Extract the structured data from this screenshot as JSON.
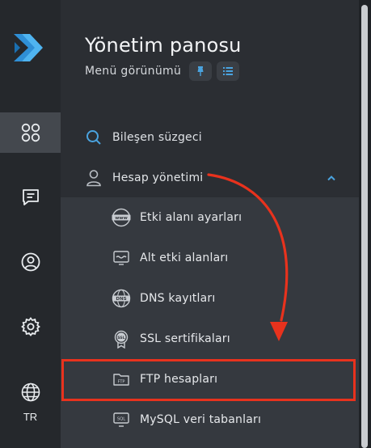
{
  "header": {
    "title": "Yönetim panosu",
    "subtitle": "Menü görünümü"
  },
  "rail": {
    "items": [
      {
        "icon": "apps-grid-icon",
        "active": true
      },
      {
        "icon": "chat-icon",
        "active": false
      },
      {
        "icon": "user-circle-icon",
        "active": false
      },
      {
        "icon": "settings-gear-icon",
        "active": false
      }
    ],
    "language": "TR"
  },
  "search": {
    "placeholder": "Bileşen süzgeci"
  },
  "section": {
    "label": "Hesap yönetimi",
    "expanded": true
  },
  "submenu": [
    {
      "label": "Etki alanı ayarları",
      "icon": "www-globe-icon"
    },
    {
      "label": "Alt etki alanları",
      "icon": "subdomain-monitor-icon"
    },
    {
      "label": "DNS kayıtları",
      "icon": "dns-globe-icon"
    },
    {
      "label": "SSL sertifikaları",
      "icon": "ssl-badge-icon"
    },
    {
      "label": "FTP hesapları",
      "icon": "ftp-folder-icon",
      "highlighted": true
    },
    {
      "label": "MySQL veri tabanları",
      "icon": "sql-icon"
    }
  ],
  "colors": {
    "accent_blue": "#4aa3df",
    "highlight_red": "#e8321d",
    "rail_bg": "#25282c",
    "panel_bg": "#2b2e33",
    "submenu_bg": "#35393f"
  }
}
